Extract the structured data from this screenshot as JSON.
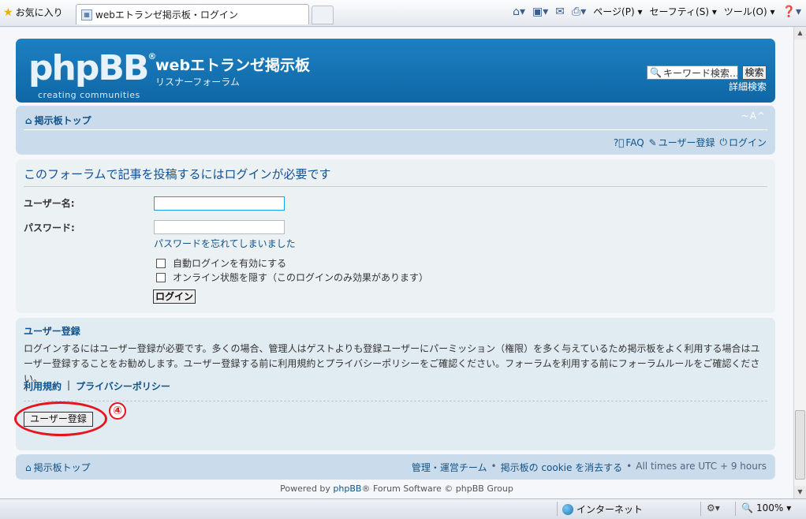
{
  "browser": {
    "favorites_label": "お気に入り",
    "tab_title": "webエトランゼ掲示板・ログイン",
    "toolbar": {
      "page_label": "ページ(P)",
      "safety_label": "セーフティ(S)",
      "tools_label": "ツール(O)"
    },
    "status": {
      "zone_label": "インターネット",
      "zoom_label": "100%"
    }
  },
  "header": {
    "logo_text": "phpBB",
    "logo_tagline": "creating communities",
    "site_title": "webエトランゼ掲示板",
    "site_description": "リスナーフォーラム",
    "search_placeholder": "キーワード検索…",
    "search_button": "検索",
    "advanced_search": "詳細検索"
  },
  "navbar": {
    "home_link": "掲示板トップ",
    "font_controls": "~A^",
    "links": {
      "faq": "FAQ",
      "register": "ユーザー登録",
      "login": "ログイン"
    }
  },
  "login_panel": {
    "title": "このフォーラムで記事を投稿するにはログインが必要です",
    "username_label": "ユーザー名:",
    "password_label": "パスワード:",
    "forgot_password": "パスワードを忘れてしまいました",
    "auto_login": "自動ログインを有効にする",
    "hide_online": "オンライン状態を隠す（このログインのみ効果があります）",
    "login_button": "ログイン"
  },
  "register_panel": {
    "title": "ユーザー登録",
    "description": "ログインするにはユーザー登録が必要です。多くの場合、管理人はゲストよりも登録ユーザーにパーミッション（権限）を多く与えているため掲示板をよく利用する場合はユーザー登録することをお勧めします。ユーザー登録する前に利用規約とプライバシーポリシーをご確認ください。フォーラムを利用する前にフォーラムルールをご確認ください。",
    "terms_link": "利用規約",
    "link_separator": "|",
    "privacy_link": "プライバシーポリシー",
    "register_button": "ユーザー登録",
    "annotation": "④"
  },
  "footer": {
    "home_link": "掲示板トップ",
    "team_link": "管理・運営チーム",
    "bullet": "•",
    "cookie_link": "掲示板の cookie を消去する",
    "timezone": "All times are UTC + 9 hours",
    "powered_prefix": "Powered by",
    "powered_link": "phpBB",
    "powered_suffix": "® Forum Software © phpBB Group"
  },
  "colors": {
    "header_blue": "#1278bd",
    "link_blue": "#105289",
    "annotation_red": "#e8141c"
  }
}
